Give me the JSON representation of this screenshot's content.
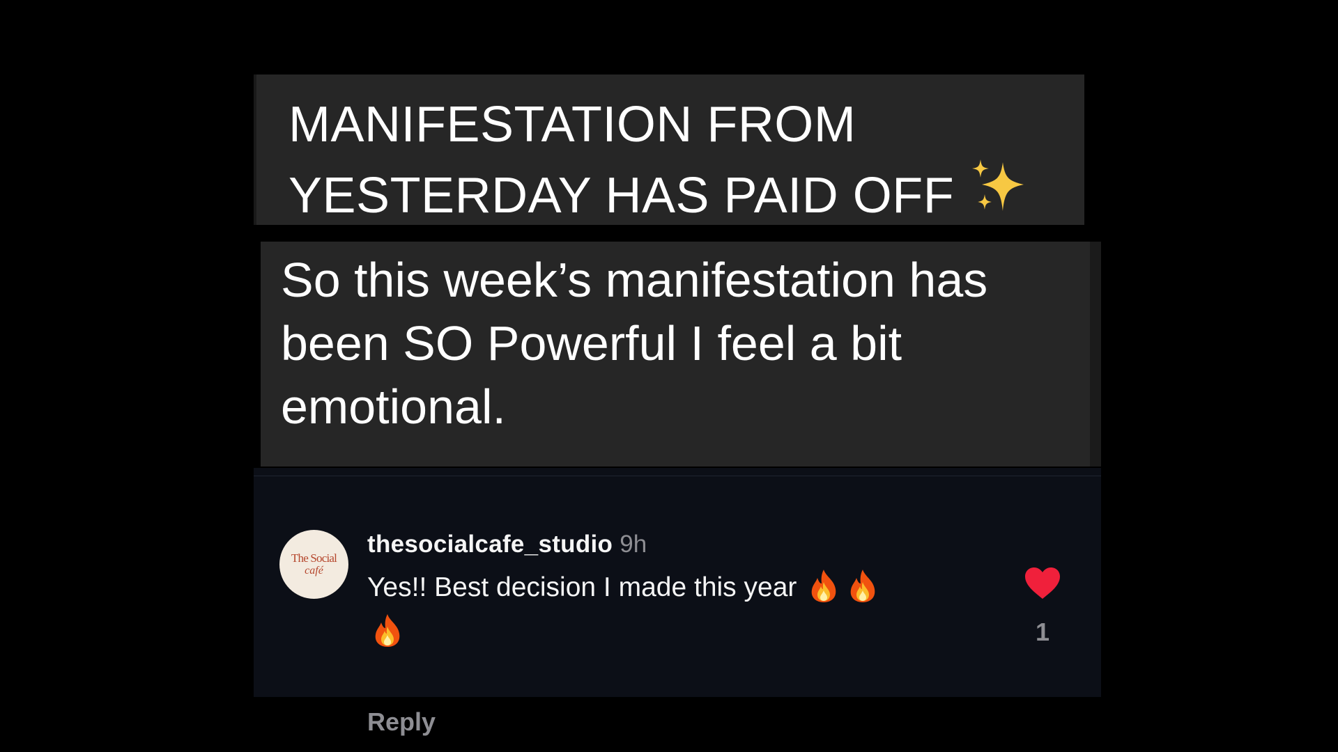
{
  "post": {
    "headline": "MANIFESTATION FROM\nYESTERDAY HAS PAID OFF",
    "headline_icon": "sparkles-icon",
    "body": "So this week’s manifestation has\nbeen SO Powerful I feel a bit\nemotional."
  },
  "comment": {
    "avatar_icon": "the-social-cafe-logo",
    "avatar_logo_text": "The Social café",
    "username": "thesocialcafe_studio",
    "time_ago": "9h",
    "text": "Yes!! Best decision I made this year",
    "emoji_icons": [
      "fire-icon",
      "fire-icon",
      "fire-icon"
    ],
    "reply_label": "Reply",
    "like_icon": "heart-icon",
    "like_count": "1",
    "colors": {
      "heart": "#f0203b",
      "muted_text": "#8e8e93",
      "panel_bg": "#0c0f17"
    }
  }
}
